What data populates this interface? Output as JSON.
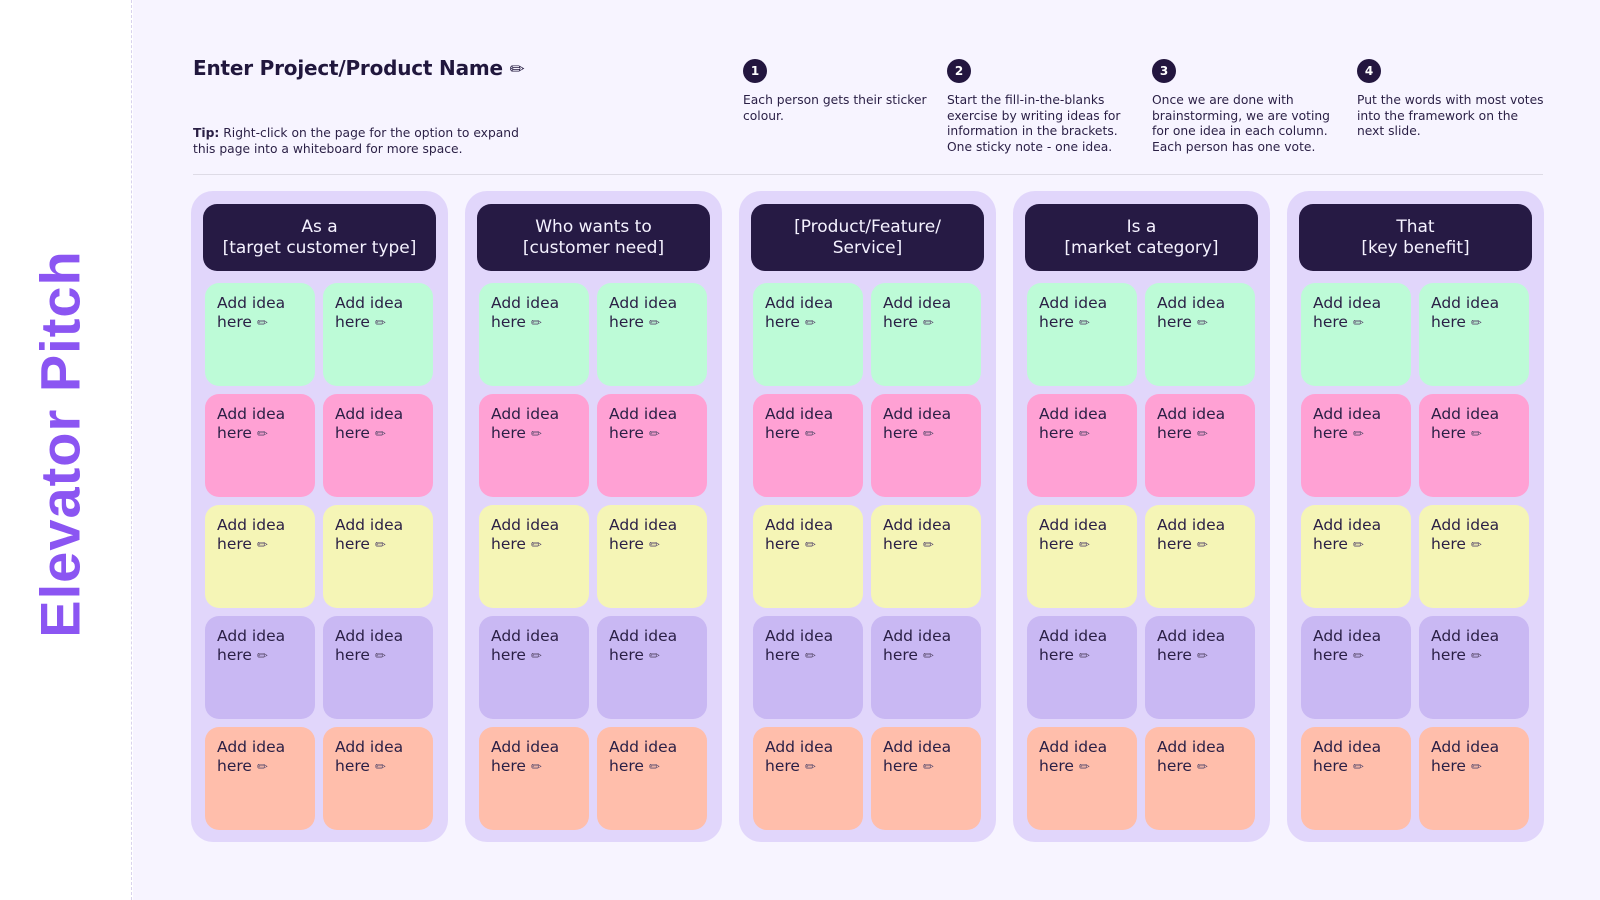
{
  "rail": {
    "title": "Elevator Pitch"
  },
  "header": {
    "title": "Enter Project/Product Name",
    "title_icon": "pencil-icon",
    "title_icon_glyph": "✏",
    "tip_label": "Tip:",
    "tip_text": " Right-click on the page for the option to expand this page into a whiteboard for more space."
  },
  "steps": [
    {
      "number": "1",
      "text": "Each person gets their sticker colour."
    },
    {
      "number": "2",
      "text": "Start the fill-in-the-blanks exercise by writing ideas for information in the brackets. One sticky note - one idea."
    },
    {
      "number": "3",
      "text": "Once we are done with brainstorming, we are voting for one idea in each column. Each person has one vote."
    },
    {
      "number": "4",
      "text": "Put the words with most votes into the framework on the next slide."
    }
  ],
  "note_colors": {
    "green": "#bdfbd7",
    "pink": "#ffa1d4",
    "yellow": "#f5f5b6",
    "purple": "#c9b8f3",
    "peach": "#ffbeab"
  },
  "note_placeholder": "Add idea\nhere",
  "note_icon_glyph": "✏",
  "columns": [
    {
      "header": "As a\n[target customer type]"
    },
    {
      "header": "Who wants to\n[customer need]"
    },
    {
      "header": "[Product/Feature/\nService]"
    },
    {
      "header": "Is a\n[market category]"
    },
    {
      "header": "That\n[key benefit]"
    }
  ],
  "rows": [
    "green",
    "pink",
    "yellow",
    "purple",
    "peach"
  ]
}
